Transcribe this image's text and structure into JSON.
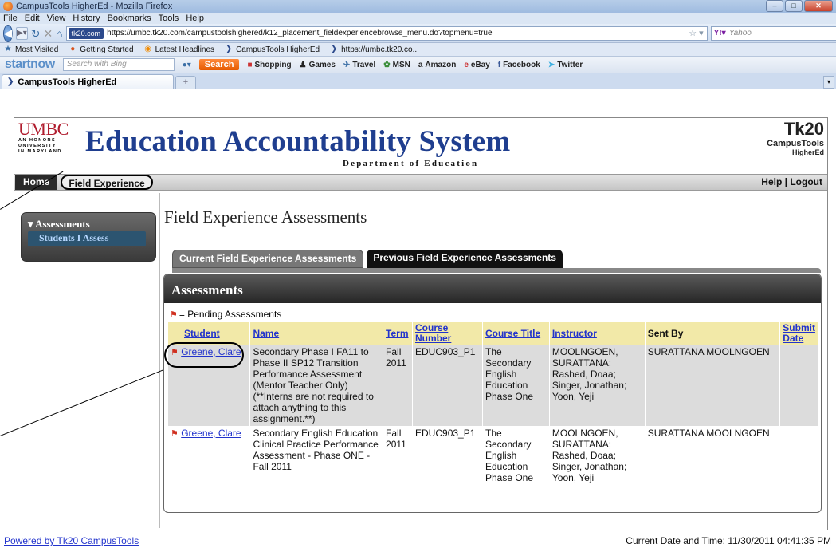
{
  "browser": {
    "window_title": "CampusTools HigherEd - Mozilla Firefox",
    "menu": [
      "File",
      "Edit",
      "View",
      "History",
      "Bookmarks",
      "Tools",
      "Help"
    ],
    "site_badge": "tk20.com",
    "url": "https://umbc.tk20.com/campustoolshighered/k12_placement_fieldexperiencebrowse_menu.do?topmenu=true",
    "search_placeholder": "Yahoo",
    "bookmarks": [
      "Most Visited",
      "Getting Started",
      "Latest Headlines",
      "CampusTools HigherEd",
      "https://umbc.tk20.co..."
    ],
    "toolbar": {
      "logo": "startnow",
      "search_placeholder": "Search with Bing",
      "search_button": "Search",
      "items": [
        "Shopping",
        "Games",
        "Travel",
        "MSN",
        "Amazon",
        "eBay",
        "Facebook",
        "Twitter"
      ]
    },
    "tab_title": "CampusTools HigherEd"
  },
  "header": {
    "umbc": "UMBC",
    "umbc_sub": [
      "AN HONORS",
      "UNIVERSITY",
      "IN MARYLAND"
    ],
    "title": "Education Accountability System",
    "department": "Department of Education",
    "tk20_logo": "Tk20",
    "tk20_line1": "CampusTools",
    "tk20_line2": "HigherEd"
  },
  "nav": {
    "home": "Home",
    "field_experience": "Field Experience",
    "help": "Help",
    "separator": "|",
    "logout": "Logout"
  },
  "sidebar": {
    "heading": "Assessments",
    "item": "Students I Assess"
  },
  "main": {
    "title": "Field Experience Assessments",
    "tabs": [
      "Current Field Experience Assessments",
      "Previous Field Experience Assessments"
    ],
    "panel_title": "Assessments",
    "pending_legend": "= Pending Assessments",
    "columns": [
      "Student",
      "Name",
      "Term",
      "Course Number",
      "Course Title",
      "Instructor",
      "Sent By",
      "Submit Date"
    ],
    "rows": [
      {
        "student": "Greene, Clare",
        "name": "Secondary Phase I FA11 to Phase II SP12 Transition Performance Assessment (Mentor Teacher Only) (**Interns are not required to attach anything to this assignment.**)",
        "term": "Fall 2011",
        "course_number": "EDUC903_P1",
        "course_title": "The Secondary English Education Phase One",
        "instructor": "MOOLNGOEN, SURATTANA; Rashed, Doaa; Singer, Jonathan; Yoon, Yeji",
        "sent_by": "SURATTANA MOOLNGOEN",
        "submit_date": ""
      },
      {
        "student": "Greene, Clare",
        "name": "Secondary English Education Clinical Practice Performance Assessment - Phase ONE - Fall 2011",
        "term": "Fall 2011",
        "course_number": "EDUC903_P1",
        "course_title": "The Secondary English Education Phase One",
        "instructor": "MOOLNGOEN, SURATTANA; Rashed, Doaa; Singer, Jonathan; Yoon, Yeji",
        "sent_by": "SURATTANA MOOLNGOEN",
        "submit_date": ""
      }
    ]
  },
  "footer": {
    "powered_by": "Powered by Tk20 CampusTools",
    "datetime": "Current Date and Time: 11/30/2011 04:41:35 PM"
  }
}
